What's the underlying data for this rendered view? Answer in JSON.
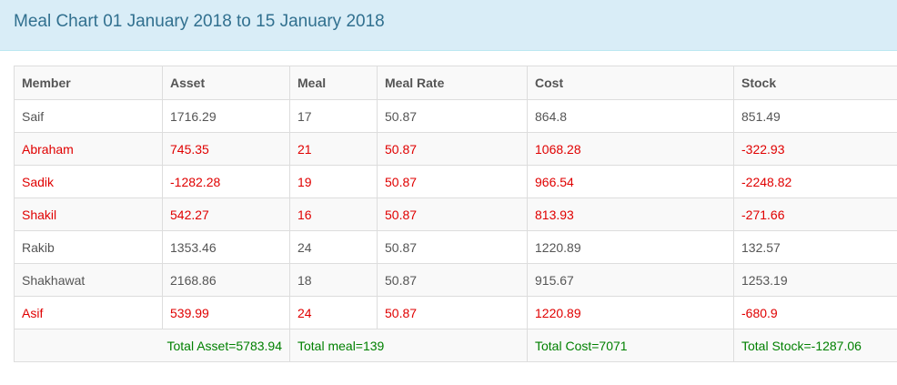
{
  "header": {
    "title": "Meal Chart 01 January 2018 to 15 January 2018"
  },
  "table": {
    "columns": [
      "Member",
      "Asset",
      "Meal",
      "Meal Rate",
      "Cost",
      "Stock"
    ],
    "rows": [
      {
        "member": "Saif",
        "asset": "1716.29",
        "meal": "17",
        "meal_rate": "50.87",
        "cost": "864.8",
        "stock": "851.49",
        "negative": false
      },
      {
        "member": "Abraham",
        "asset": "745.35",
        "meal": "21",
        "meal_rate": "50.87",
        "cost": "1068.28",
        "stock": "-322.93",
        "negative": true
      },
      {
        "member": "Sadik",
        "asset": "-1282.28",
        "meal": "19",
        "meal_rate": "50.87",
        "cost": "966.54",
        "stock": "-2248.82",
        "negative": true
      },
      {
        "member": "Shakil",
        "asset": "542.27",
        "meal": "16",
        "meal_rate": "50.87",
        "cost": "813.93",
        "stock": "-271.66",
        "negative": true
      },
      {
        "member": "Rakib",
        "asset": "1353.46",
        "meal": "24",
        "meal_rate": "50.87",
        "cost": "1220.89",
        "stock": "132.57",
        "negative": false
      },
      {
        "member": "Shakhawat",
        "asset": "2168.86",
        "meal": "18",
        "meal_rate": "50.87",
        "cost": "915.67",
        "stock": "1253.19",
        "negative": false
      },
      {
        "member": "Asif",
        "asset": "539.99",
        "meal": "24",
        "meal_rate": "50.87",
        "cost": "1220.89",
        "stock": "-680.9",
        "negative": true
      }
    ],
    "totals": {
      "asset": "Total Asset=5783.94",
      "meal": "Total meal=139",
      "cost": "Total Cost=7071",
      "stock": "Total Stock=-1287.06"
    }
  },
  "colors": {
    "header_bg": "#d9edf7",
    "title": "#31708f",
    "negative_row": "#e00000",
    "totals": "#008000"
  }
}
